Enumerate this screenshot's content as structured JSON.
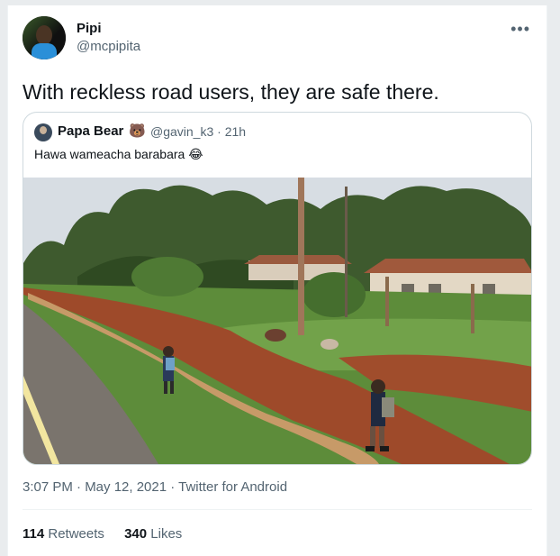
{
  "author": {
    "name": "Pipi",
    "handle": "@mcpipita"
  },
  "tweet": {
    "text": "With reckless road users, they are safe there."
  },
  "more_icon": "more-options-icon",
  "quoted": {
    "name": "Papa Bear",
    "name_emoji": "🐻",
    "meta": "@gavin_k3 · 21h",
    "text": "Hawa wameacha barabara",
    "text_emoji": "😂"
  },
  "footer": {
    "timestamp": "3:07 PM · May 12, 2021 · Twitter for Android",
    "retweets_count": "114",
    "retweets_label": "Retweets",
    "likes_count": "340",
    "likes_label": "Likes"
  },
  "colors": {
    "text": "#0f1419",
    "secondary": "#536471",
    "border": "#cfd9de"
  }
}
